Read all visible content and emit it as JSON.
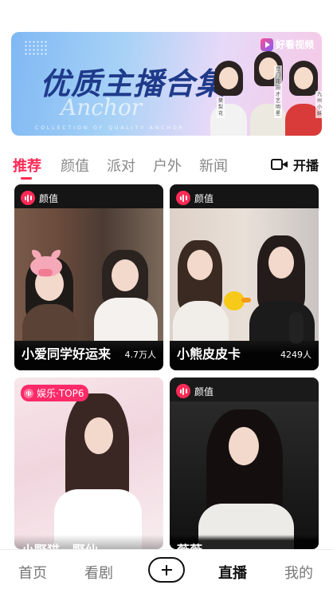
{
  "banner": {
    "title": "优质主播合集",
    "script": "Anchor",
    "subtitle": "COLLECTION OF QUALITY ANCHOR",
    "brand": "好看视频",
    "portrait_tags": [
      "樊梨花",
      "豆门花田才艺明星",
      "九州小妹"
    ]
  },
  "tabs": [
    {
      "label": "推荐",
      "active": true
    },
    {
      "label": "颜值",
      "active": false
    },
    {
      "label": "派对",
      "active": false
    },
    {
      "label": "户外",
      "active": false
    },
    {
      "label": "新闻",
      "active": false
    }
  ],
  "broadcast": {
    "label": "开播",
    "icon": "camera-icon"
  },
  "cards": [
    {
      "badge": "颜值",
      "name": "小爱同学好运来",
      "viewers": "4.7万人"
    },
    {
      "badge": "颜值",
      "name": "小熊皮皮卡",
      "viewers": "4249人"
    },
    {
      "badge": "娱乐·TOP6",
      "name": "小野猫一野仙",
      "viewers": ""
    },
    {
      "badge": "颜值",
      "name": "薇薇",
      "viewers": ""
    }
  ],
  "nav": [
    {
      "label": "首页",
      "active": false
    },
    {
      "label": "看剧",
      "active": false
    },
    {
      "label": "直播",
      "active": true
    },
    {
      "label": "我的",
      "active": false
    }
  ],
  "colors": {
    "accent": "#ff2a55",
    "text": "#111111",
    "muted": "#888888"
  }
}
